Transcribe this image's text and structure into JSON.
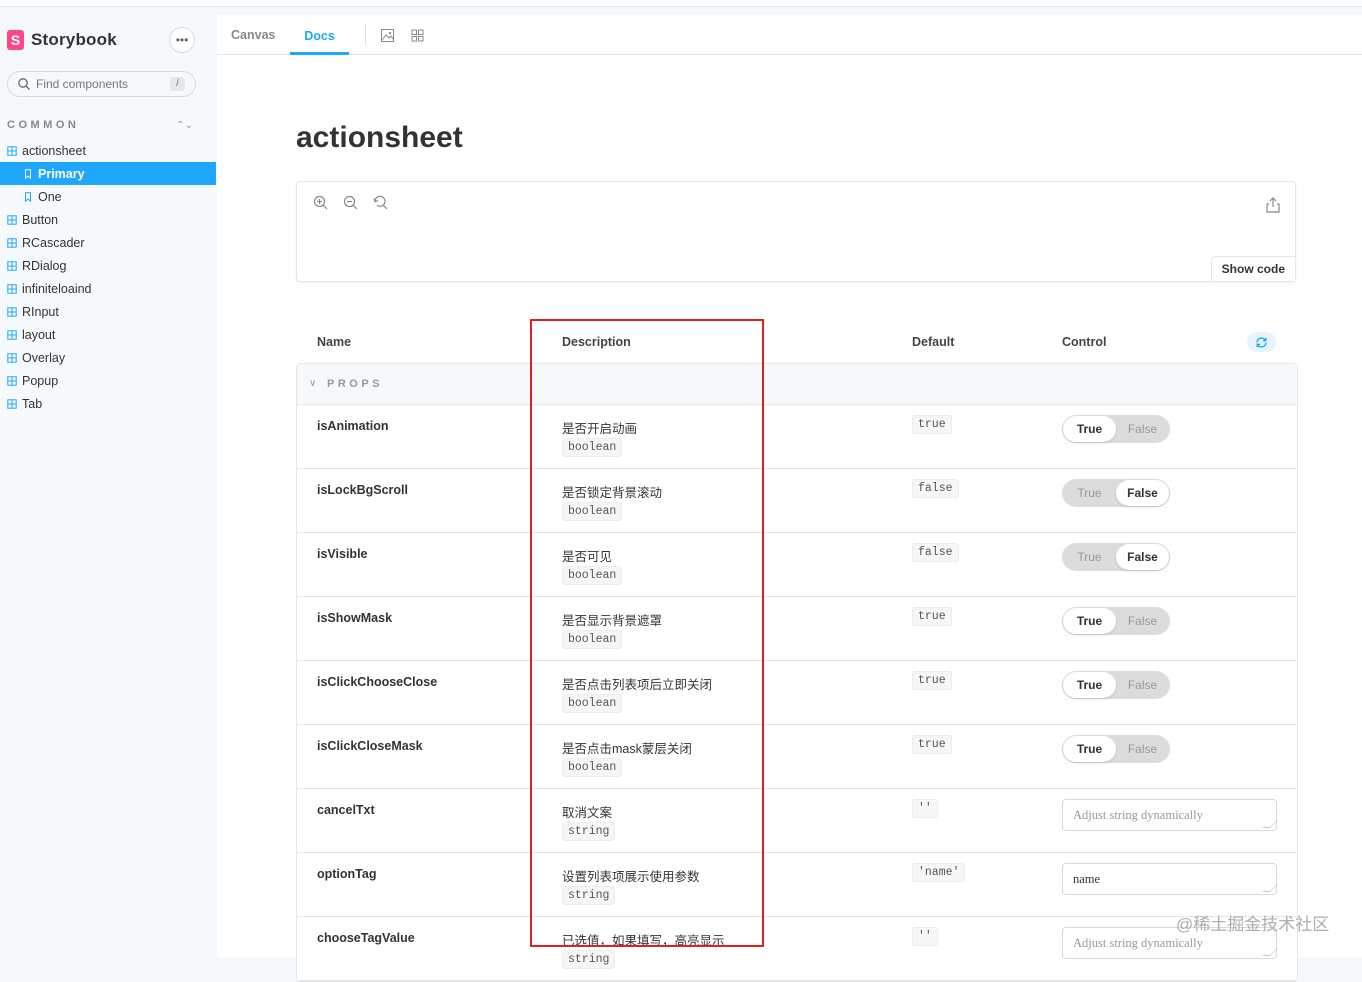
{
  "app": {
    "name": "Storybook"
  },
  "sidebar": {
    "search_placeholder": "Find components",
    "search_shortcut": "/",
    "section_label": "COMMON",
    "items": [
      {
        "label": "actionsheet",
        "kind": "component"
      },
      {
        "label": "Primary",
        "kind": "story",
        "active": true
      },
      {
        "label": "One",
        "kind": "story"
      },
      {
        "label": "Button",
        "kind": "component"
      },
      {
        "label": "RCascader",
        "kind": "component"
      },
      {
        "label": "RDialog",
        "kind": "component"
      },
      {
        "label": "infiniteloaind",
        "kind": "component"
      },
      {
        "label": "RInput",
        "kind": "component"
      },
      {
        "label": "layout",
        "kind": "component"
      },
      {
        "label": "Overlay",
        "kind": "component"
      },
      {
        "label": "Popup",
        "kind": "component"
      },
      {
        "label": "Tab",
        "kind": "component"
      }
    ]
  },
  "toolbar": {
    "tabs": [
      "Canvas",
      "Docs"
    ],
    "active_tab": "Docs"
  },
  "docs": {
    "title": "actionsheet",
    "show_code_label": "Show code",
    "columns": [
      "Name",
      "Description",
      "Default",
      "Control"
    ],
    "group_label": "PROPS",
    "props": [
      {
        "name": "isAnimation",
        "description": "是否开启动画",
        "type": "boolean",
        "default": "true",
        "control": "toggle",
        "value": true
      },
      {
        "name": "isLockBgScroll",
        "description": "是否锁定背景滚动",
        "type": "boolean",
        "default": "false",
        "control": "toggle",
        "value": false
      },
      {
        "name": "isVisible",
        "description": "是否可见",
        "type": "boolean",
        "default": "false",
        "control": "toggle",
        "value": false
      },
      {
        "name": "isShowMask",
        "description": "是否显示背景遮罩",
        "type": "boolean",
        "default": "true",
        "control": "toggle",
        "value": true
      },
      {
        "name": "isClickChooseClose",
        "description": "是否点击列表项后立即关闭",
        "type": "boolean",
        "default": "true",
        "control": "toggle",
        "value": true
      },
      {
        "name": "isClickCloseMask",
        "description": "是否点击mask蒙层关闭",
        "type": "boolean",
        "default": "true",
        "control": "toggle",
        "value": true
      },
      {
        "name": "cancelTxt",
        "description": "取消文案",
        "type": "string",
        "default": "''",
        "control": "text",
        "text_value": "",
        "placeholder": "Adjust string dynamically"
      },
      {
        "name": "optionTag",
        "description": "设置列表项展示使用参数",
        "type": "string",
        "default": "'name'",
        "control": "text",
        "text_value": "name",
        "placeholder": "Adjust string dynamically"
      },
      {
        "name": "chooseTagValue",
        "description": "已选值，如果填写，高亮显示",
        "type": "string",
        "default": "''",
        "control": "text",
        "text_value": "",
        "placeholder": "Adjust string dynamically"
      }
    ],
    "toggle_labels": {
      "true": "True",
      "false": "False"
    }
  },
  "watermark": "@稀土掘金技术社区",
  "colors": {
    "accent": "#1ea7fd",
    "brand": "#ff4785",
    "highlight": "#e02020"
  }
}
